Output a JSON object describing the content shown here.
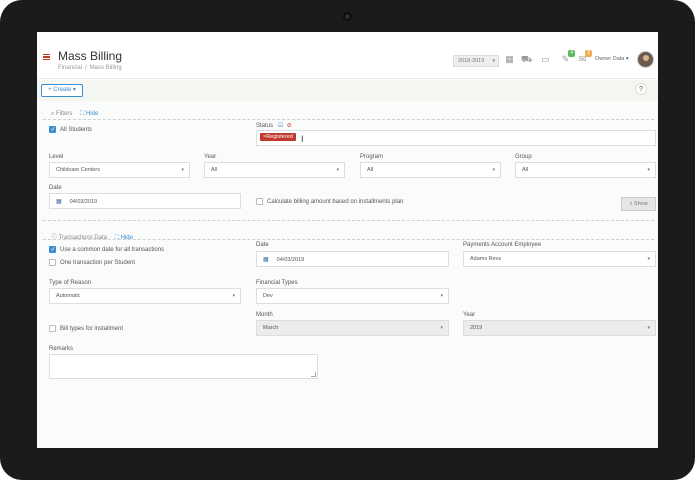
{
  "header": {
    "title": "Mass Billing",
    "breadcrumb": [
      "Financial",
      "/",
      "Mass Billing"
    ],
    "year_select": "2018-2019",
    "notif_count_green": "4",
    "notif_count_orange": "2",
    "user_name": "Owner Data"
  },
  "toolbar": {
    "create_label": "+ Create",
    "help_label": "?"
  },
  "filters": {
    "heading": "Filters",
    "hide_label": "Hide",
    "all_students_label": "All Students",
    "status_label": "Status",
    "status_tag": "×Registered",
    "level_label": "Level",
    "level_value": "Childcare Centers",
    "year_label": "Year",
    "year_value": "All",
    "program_label": "Program",
    "program_value": "All",
    "group_label": "Group",
    "group_value": "All",
    "date_label": "Date",
    "date_value": "04/03/2019",
    "calc_label": "Calculate billing amount based on installments plan",
    "show_label": "Show"
  },
  "transactions": {
    "heading": "Transactions Data",
    "hide_label": "Hide",
    "common_date_label": "Use a common date for all transactions",
    "one_per_student_label": "One transaction per Student",
    "date_label": "Date",
    "date_value": "04/03/2019",
    "employee_label": "Payments Account Employee",
    "employee_value": "Adams Revs",
    "reason_label": "Type of Reason",
    "reason_value": "Automatic",
    "financial_label": "Financial Types",
    "financial_value": "Dev",
    "bill_types_label": "Bill types for installment",
    "month_label": "Month",
    "month_value": "March",
    "year_label": "Year",
    "year_value": "2019",
    "remarks_label": "Remarks"
  },
  "colors": {
    "accent": "#3b8dd1",
    "brand_red": "#c0392b",
    "frame": "#1b1b1b"
  }
}
